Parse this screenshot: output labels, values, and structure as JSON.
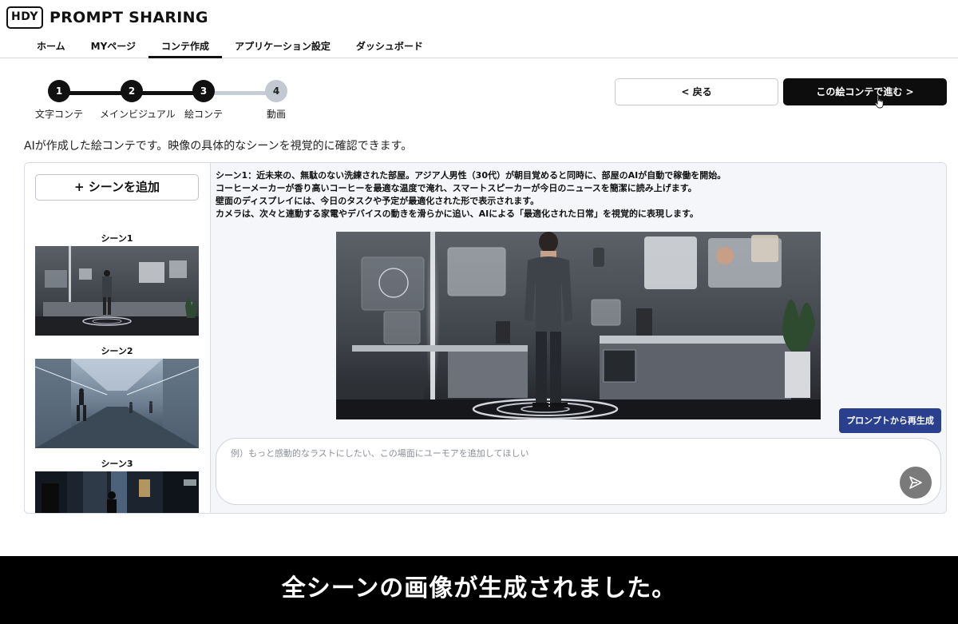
{
  "app": {
    "logo_badge": "HDY",
    "logo_text": "PROMPT SHARING"
  },
  "nav": {
    "items": [
      {
        "label": "ホーム"
      },
      {
        "label": "MYページ"
      },
      {
        "label": "コンテ作成"
      },
      {
        "label": "アプリケーション設定"
      },
      {
        "label": "ダッシュボード"
      }
    ],
    "active_index": 2
  },
  "stepper": {
    "steps": [
      {
        "number": "1",
        "label": "文字コンテ",
        "state": "done"
      },
      {
        "number": "2",
        "label": "メインビジュアル",
        "state": "done"
      },
      {
        "number": "3",
        "label": "絵コンテ",
        "state": "current"
      },
      {
        "number": "4",
        "label": "動画",
        "state": "todo"
      }
    ]
  },
  "buttons": {
    "back_label": "< 戻る",
    "next_label": "この絵コンテで進む >"
  },
  "description": "AIが作成した絵コンテです。映像の具体的なシーンを視覚的に確認できます。",
  "scene_list": {
    "add_label": "+ シーンを追加",
    "scenes": [
      {
        "title": "シーン1"
      },
      {
        "title": "シーン2"
      },
      {
        "title": "シーン3"
      }
    ]
  },
  "detail": {
    "lines": [
      "シーン1：近未来の、無駄のない洗練された部屋。アジア人男性（30代）が朝目覚めると同時に、部屋のAIが自動で稼働を開始。",
      "コーヒーメーカーが香り高いコーヒーを最適な温度で淹れ、スマートスピーカーが今日のニュースを簡潔に読み上げます。",
      "壁面のディスプレイには、今日のタスクや予定が最適化された形で表示されます。",
      "カメラは、次々と連動する家電やデバイスの動きを滑らかに追い、AIによる「最適化された日常」を視覚的に表現します。"
    ],
    "regen_label": "プロンプトから再生成",
    "prompt_placeholder": "例）もっと感動的なラストにしたい、この場面にユーモアを追加してほしい",
    "prompt_value": ""
  },
  "caption": "全シーンの画像が生成されました。",
  "colors": {
    "primary_dark": "#0d0d0d",
    "regen_blue": "#2a3f8e",
    "step_todo": "#c3c9d2",
    "panel_bg": "#f4f6f9"
  }
}
